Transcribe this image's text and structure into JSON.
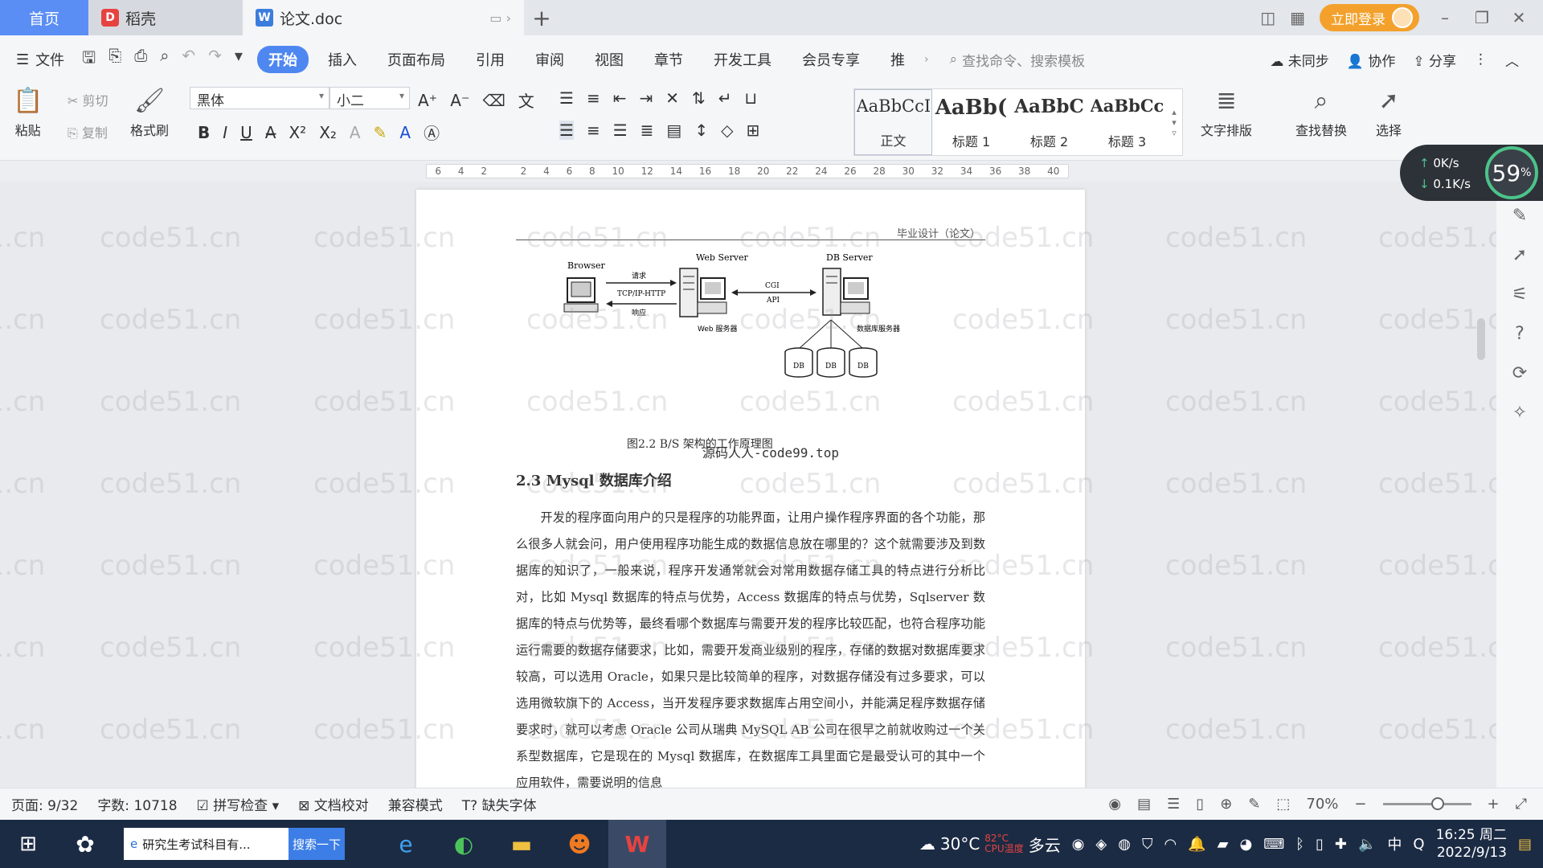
{
  "tabs": {
    "home": "首页",
    "daoke": "稻壳",
    "doc": "论文.doc"
  },
  "tabbar_right": {
    "login": "立即登录"
  },
  "menubar": {
    "file": "文件",
    "items": [
      "开始",
      "插入",
      "页面布局",
      "引用",
      "审阅",
      "视图",
      "章节",
      "开发工具",
      "会员专享",
      "推"
    ],
    "active": "开始",
    "search_placeholder": "查找命令、搜索模板",
    "sync": "未同步",
    "collab": "协作",
    "share": "分享"
  },
  "ribbon": {
    "paste": "粘贴",
    "cut": "剪切",
    "copy": "复制",
    "format_painter": "格式刷",
    "font": "黑体",
    "size": "小二",
    "styles": [
      {
        "preview": "AaBbCcI",
        "label": "正文"
      },
      {
        "preview": "AaBb(",
        "label": "标题 1"
      },
      {
        "preview": "AaBbC",
        "label": "标题 2"
      },
      {
        "preview": "AaBbCcI",
        "label": "标题 3"
      }
    ],
    "text_layout": "文字排版",
    "find_replace": "查找替换",
    "select": "选择"
  },
  "ruler": {
    "ticks": [
      "6",
      "4",
      "2",
      "",
      "2",
      "4",
      "6",
      "8",
      "10",
      "12",
      "14",
      "16",
      "18",
      "20",
      "22",
      "24",
      "26",
      "28",
      "30",
      "32",
      "34",
      "36",
      "38",
      "40"
    ]
  },
  "document": {
    "page_header": "毕业设计（论文）",
    "diagram": {
      "browser": "Browser",
      "web_server": "Web Server",
      "db_server": "DB Server",
      "request": "请求",
      "protocol": "TCP/IP-HTTP",
      "response": "响应",
      "cgi": "CGI",
      "api": "API",
      "web_service": "Web 服务器",
      "db_service": "数据库服务器",
      "db": "DB"
    },
    "caption": "图2.2 B/S 架构的工作原理图",
    "watermark_caption": "源码人人-code99.top",
    "section_title": "2.3 Mysql 数据库介绍",
    "paragraph": "开发的程序面向用户的只是程序的功能界面，让用户操作程序界面的各个功能，那么很多人就会问，用户使用程序功能生成的数据信息放在哪里的？这个就需要涉及到数据库的知识了，一般来说，程序开发通常就会对常用数据存储工具的特点进行分析比对，比如 Mysql 数据库的特点与优势，Access 数据库的特点与优势，Sqlserver 数据库的特点与优势等，最终看哪个数据库与需要开发的程序比较匹配，也符合程序功能运行需要的数据存储要求，比如，需要开发商业级别的程序，存储的数据对数据库要求较高，可以选用 Oracle，如果只是比较简单的程序，对数据存储没有过多要求，可以选用微软旗下的 Access，当开发程序要求数据库占用空间小，并能满足程序数据存储要求时，就可以考虑 Oracle 公司从瑞典 MySQL AB 公司在很早之前就收购过一个关系型数据库，它是现在的 Mysql 数据库，在数据库工具里面它是最受认可的其中一个应用软件，需要说明的信息"
  },
  "watermark_text": "code51.cn",
  "net_widget": {
    "up": "0K/s",
    "down": "0.1K/s",
    "percent": "59"
  },
  "statusbar": {
    "page": "页面: 9/32",
    "words": "字数: 10718",
    "spell": "拼写检查",
    "proof": "文档校对",
    "compat": "兼容模式",
    "missing_font": "缺失字体",
    "zoom": "70%"
  },
  "taskbar": {
    "search_text": "研究生考试科目有...",
    "search_btn": "搜索一下",
    "temp": "30°C",
    "weather": "多云",
    "cpu_temp": "82°C",
    "cpu_label": "CPU温度",
    "ime": "中",
    "time": "16:25 周二",
    "date": "2022/9/13"
  }
}
